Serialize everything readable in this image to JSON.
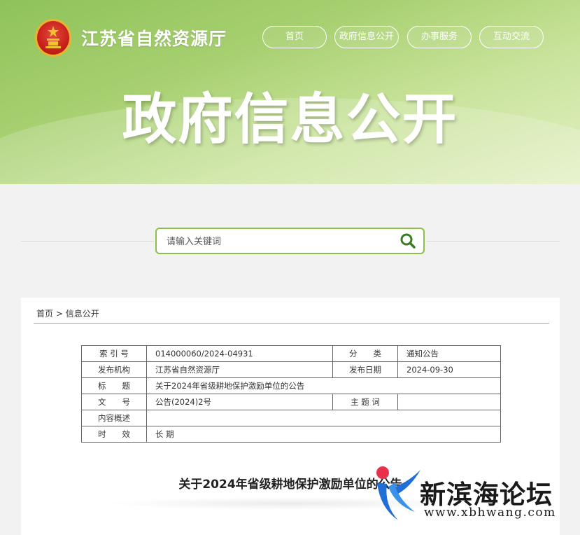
{
  "header": {
    "agency_name": "江苏省自然资源厅",
    "hero_title": "政府信息公开",
    "nav": [
      {
        "label": "首页"
      },
      {
        "label": "政府信息公开"
      },
      {
        "label": "办事服务"
      },
      {
        "label": "互动交流"
      }
    ]
  },
  "search": {
    "placeholder": "请输入关键词",
    "button_icon": "search-icon"
  },
  "breadcrumb": {
    "home": "首页",
    "separator": " > ",
    "current": "信息公开"
  },
  "meta_table": {
    "index_label": "索 引 号",
    "index_value": "014000060/2024-04931",
    "category_label": "分　　类",
    "category_value": "通知公告",
    "publisher_label": "发布机构",
    "publisher_value": "江苏省自然资源厅",
    "date_label": "发布日期",
    "date_value": "2024-09-30",
    "title_label": "标　　题",
    "title_value": "关于2024年省级耕地保护激励单位的公告",
    "doc_no_label": "文　　号",
    "doc_no_value": "公告(2024)2号",
    "subject_label": "主 题 词",
    "subject_value": "",
    "summary_label": "内容概述",
    "summary_value": "",
    "validity_label": "时　　效",
    "validity_value": "长 期"
  },
  "article": {
    "title": "关于2024年省级耕地保护激励单位的公告"
  },
  "watermark": {
    "name": "新滨海论坛",
    "url": "www.xbhwang.com"
  },
  "colors": {
    "accent_green": "#8cbf4a",
    "banner_green": "#a7d070",
    "emblem_red": "#c8201b"
  }
}
